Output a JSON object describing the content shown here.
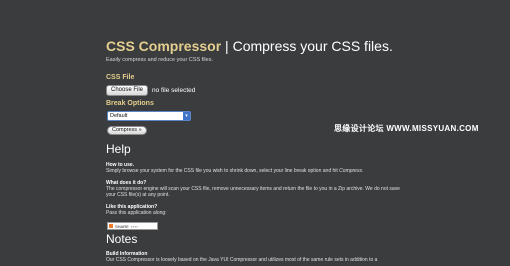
{
  "header": {
    "brand": "CSS Compressor",
    "separator": " | ",
    "rest": "Compress your CSS files.",
    "tagline": "Easily compress and reduce your CSS files."
  },
  "form": {
    "file_label": "CSS File",
    "choose_button": "Choose File",
    "no_file_text": "no file selected",
    "break_label": "Break Options",
    "break_selected": "Default",
    "compress_button": "Compress »"
  },
  "help": {
    "heading": "Help",
    "items": [
      {
        "question": "How to use.",
        "answer_pre": "Simply browse your system for the CSS file you wish to shrink down, select your line break option and hit ",
        "answer_em": "Compress",
        "answer_post": "."
      },
      {
        "question": "What does it do?",
        "answer": "The compressor engine will scan your CSS file, remove unnecessary items and return the file to you in a Zip archive. We do not save your CSS file(s) at any point."
      },
      {
        "question": "Like this application?",
        "answer": "Pass this application along:"
      }
    ],
    "share_label": "SHARE"
  },
  "notes": {
    "heading": "Notes",
    "subheading": "Build Information",
    "text": "Our CSS Compressor is loosely based on the Java YUI Compressor and utilizes most of the same rule sets in addition to a"
  },
  "watermark": "思缘设计论坛 WWW.MISSYUAN.COM",
  "colors": {
    "background": "#3a3c3d",
    "accent": "#e5cf8f",
    "select_highlight": "#3f74c9"
  }
}
